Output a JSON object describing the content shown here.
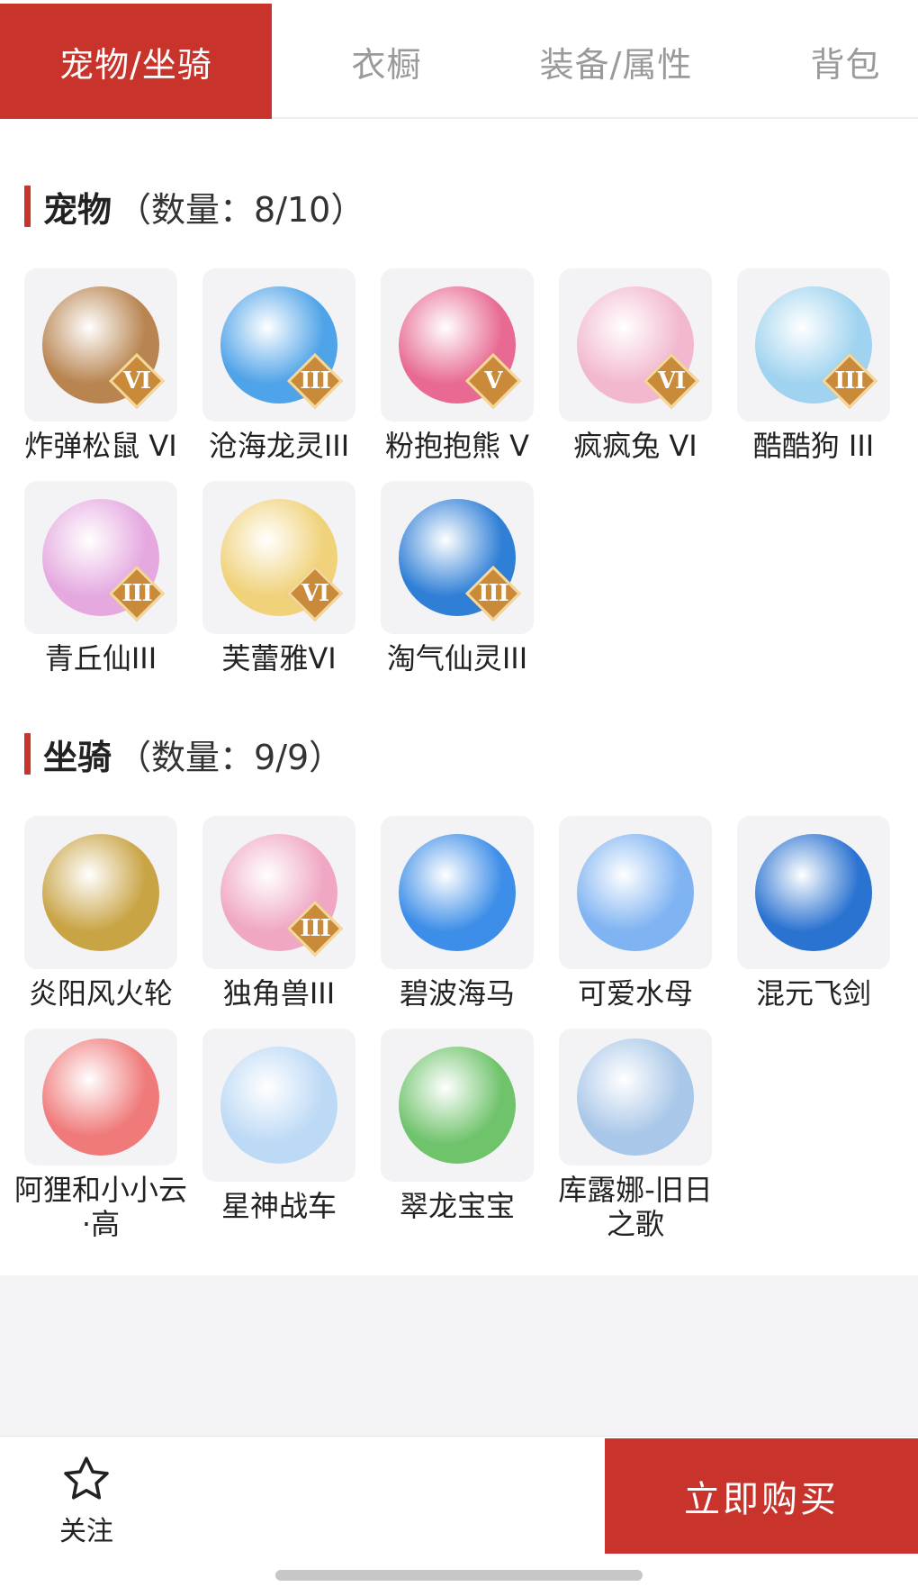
{
  "tabs": [
    {
      "label": "宠物/坐骑",
      "active": true
    },
    {
      "label": "衣橱",
      "active": false
    },
    {
      "label": "装备/属性",
      "active": false
    },
    {
      "label": "背包",
      "active": false
    }
  ],
  "pets_section": {
    "title": "宠物",
    "count": "（数量：8/10）",
    "items": [
      {
        "name": "炸弹松鼠 VI",
        "grade": "VI",
        "color": "#b8844f"
      },
      {
        "name": "沧海龙灵III",
        "grade": "III",
        "color": "#4fa3e8"
      },
      {
        "name": "粉抱抱熊 V",
        "grade": "V",
        "color": "#e86a92"
      },
      {
        "name": "疯疯兔 VI",
        "grade": "VI",
        "color": "#f2b8cf"
      },
      {
        "name": "酷酷狗 III",
        "grade": "III",
        "color": "#9fd3ef"
      },
      {
        "name": "青丘仙III",
        "grade": "III",
        "color": "#e5a9e0"
      },
      {
        "name": "芙蕾雅VI",
        "grade": "VI",
        "color": "#f0d27a"
      },
      {
        "name": "淘气仙灵III",
        "grade": "III",
        "color": "#2f7fd6"
      }
    ]
  },
  "mounts_section": {
    "title": "坐骑",
    "count": "（数量：9/9）",
    "items": [
      {
        "name": "炎阳风火轮",
        "grade": "",
        "color": "#c9a445"
      },
      {
        "name": "独角兽III",
        "grade": "III",
        "color": "#f0a7c4"
      },
      {
        "name": "碧波海马",
        "grade": "",
        "color": "#3d8ee8"
      },
      {
        "name": "可爱水母",
        "grade": "",
        "color": "#7fb3f2"
      },
      {
        "name": "混元飞剑",
        "grade": "",
        "color": "#2b73d1"
      },
      {
        "name": "阿狸和小小云·高",
        "grade": "",
        "color": "#f07a7a"
      },
      {
        "name": "星神战车",
        "grade": "",
        "color": "#bcd9f5"
      },
      {
        "name": "翠龙宝宝",
        "grade": "",
        "color": "#6fc36b"
      },
      {
        "name": "库露娜-旧日之歌",
        "grade": "",
        "color": "#a9c7e8"
      }
    ]
  },
  "bottom_bar": {
    "follow_label": "关注",
    "follow_icon": "star-outline-icon",
    "buy_label": "立即购买"
  },
  "colors": {
    "accent": "#c8332b",
    "tab_inactive": "#9a9a9a",
    "thumb_bg": "#f3f3f5",
    "badge_gold": "#c98a3a"
  }
}
